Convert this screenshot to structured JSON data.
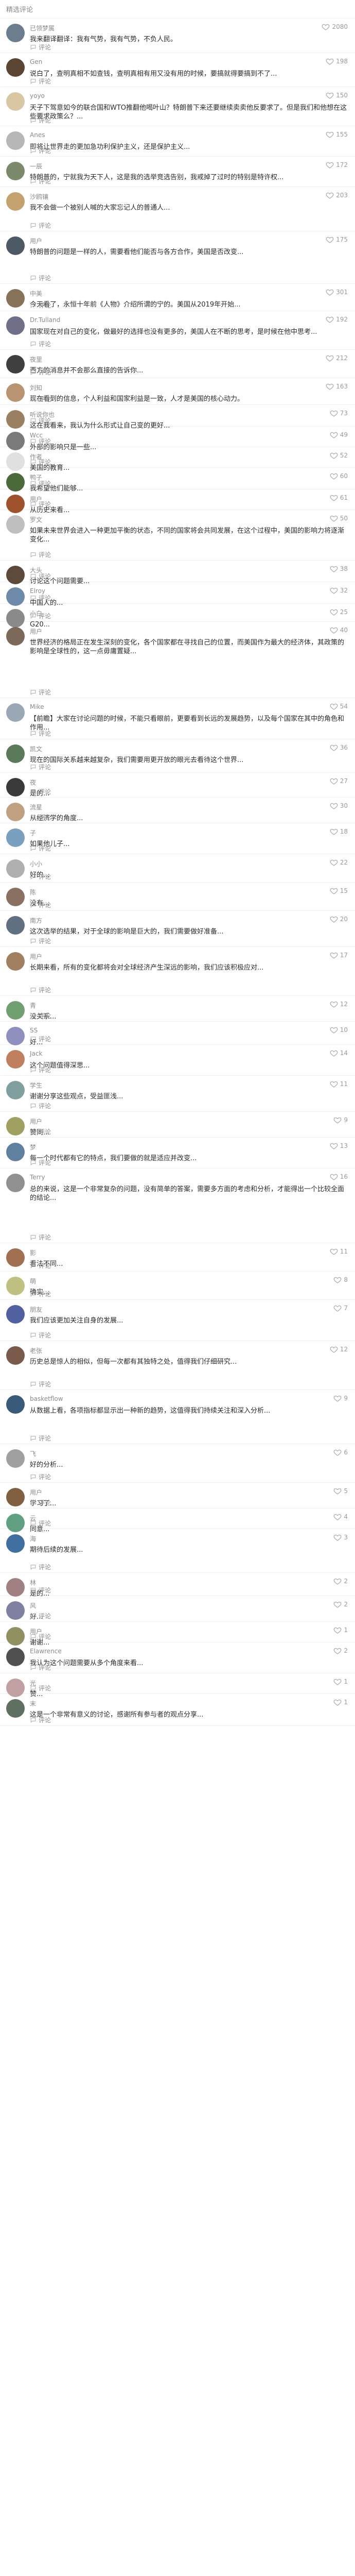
{
  "header": {
    "title": "精选评论"
  },
  "reply_label": "评论",
  "comments": [
    {
      "user": "已领梦属",
      "likes": "2080",
      "text": "我来翻译翻译：我有气势，我有气势，不负人民。",
      "av": "#6b7d8f",
      "h": 67
    },
    {
      "user": "Gen",
      "likes": "198",
      "text": "说白了，查明真相不如查钱，查明真相有用又没有用的时候，要搞就得要搞到不了...",
      "av": "#5a4632",
      "h": 66
    },
    {
      "user": "yoyo",
      "likes": "150",
      "text": "天子下驾意如今的联合国和WTO推翻他喝叶山？特朗普下来还要继续卖卖他反要求了。但是我们和他想在这些要求政策么？...",
      "av": "#d9c7a3",
      "h": 76
    },
    {
      "user": "Anes",
      "likes": "155",
      "text": "即将让世界走的更加急功利保护主义，还是保护主义...",
      "av": "#b7b7b7",
      "h": 59
    },
    {
      "user": "一辰",
      "likes": "172",
      "text": "特朗普的，宁就我为天下人，这是我的选举竞选告别，我戒掉了过时的特别是特许权...",
      "av": "#7a8a6a",
      "h": 59
    },
    {
      "user": "沙鸥镶",
      "likes": "203",
      "text": "我不会做一个被别人喊的大家忘记人的普通人...",
      "av": "#c4a26d",
      "h": 86
    },
    {
      "user": "用户",
      "likes": "175",
      "text": "特朗普的问题是一样的人，需要看他们能否与各方合作，美国是否改变...",
      "av": "#4d5a66",
      "h": 102
    },
    {
      "user": "中美",
      "likes": "301",
      "text": "今天看了，永恒十年前《人物》介绍所谓的宁的。美国从2019年开始...",
      "av": "#86735a",
      "h": 53
    },
    {
      "user": "Dr.Tulland",
      "likes": "192",
      "text": "国家现在对自己的变化，做最好的选择也没有更多的，美国人在不断的思考，是时候在他中思考...",
      "av": "#6f6f8a",
      "h": 75
    },
    {
      "user": "夜里",
      "likes": "212",
      "text": "西方的消息并不会那么直接的告诉你...",
      "av": "#3f3f3f",
      "h": 55
    },
    {
      "user": "刘知",
      "likes": "163",
      "text": "现在看到的信息，个人利益和国家利益是一致，人才是美国的核心动力。",
      "av": "#b89470",
      "h": 52
    },
    {
      "user": "听说你也",
      "likes": "73",
      "text": "这在我看来，我认为什么形式让自己变的更好...",
      "av": "#9a8060",
      "h": 42
    },
    {
      "user": "Wcc",
      "likes": "49",
      "text": "外部的影响只是一些...",
      "av": "#7a7a7a",
      "h": 40
    },
    {
      "user": "作者",
      "likes": "52",
      "text": "美国的教育...",
      "av": "#e0e0e0",
      "h": 40
    },
    {
      "user": "鸭子",
      "likes": "60",
      "text": "我希望他们能够...",
      "av": "#4a6a3a",
      "h": 42
    },
    {
      "user": "用户",
      "likes": "61",
      "text": "从历史来看...",
      "av": "#a0522d",
      "h": 40
    },
    {
      "user": "罗文",
      "likes": "50",
      "text": "如果未来世界会进入一种更加平衡的状态，不同的国家将会共同发展，在这个过程中，美国的影响力将逐渐变化...",
      "av": "#bfbfbf",
      "h": 98
    },
    {
      "user": "大头",
      "likes": "38",
      "text": "讨论这个问题需要...",
      "av": "#5c4b3a",
      "h": 42
    },
    {
      "user": "Elroy",
      "likes": "32",
      "text": "中国人的...",
      "av": "#6d8aa8",
      "h": 42
    },
    {
      "user": "小白",
      "likes": "25",
      "text": "G20...",
      "av": "#8a8a8a",
      "h": 35
    },
    {
      "user": "用户",
      "likes": "40",
      "text": "世界经济的格局正在发生深刻的变化，各个国家都在寻找自己的位置，而美国作为最大的经济体，其政策的影响是全球性的，这一点毋庸置疑...",
      "av": "#7b6a5a",
      "h": 148
    },
    {
      "user": "Mike",
      "likes": "54",
      "text": "【前瞻】大家在讨论问题的时候，不能只看眼前，更要看到长远的发展趋势，以及每个国家在其中的角色和作用...",
      "av": "#9aa7b4",
      "h": 80
    },
    {
      "user": "凯文",
      "likes": "36",
      "text": "现在的国际关系越来越复杂，我们需要用更开放的眼光去看待这个世界...",
      "av": "#5a7a5a",
      "h": 65
    },
    {
      "user": "夜",
      "likes": "27",
      "text": "是的...",
      "av": "#3a3a3a",
      "h": 48
    },
    {
      "user": "流星",
      "likes": "30",
      "text": "从经济学的角度...",
      "av": "#c0a080",
      "h": 50
    },
    {
      "user": "子",
      "likes": "18",
      "text": "如果他儿子...",
      "av": "#7aa0c0",
      "h": 60
    },
    {
      "user": "小小",
      "likes": "22",
      "text": "好的...",
      "av": "#b0b0b0",
      "h": 55
    },
    {
      "user": "陈",
      "likes": "15",
      "text": "没有...",
      "av": "#8a7060",
      "h": 55
    },
    {
      "user": "南方",
      "likes": "20",
      "text": "这次选举的结果，对于全球的影响是巨大的，我们需要做好准备...",
      "av": "#607080",
      "h": 70
    },
    {
      "user": "用户",
      "likes": "17",
      "text": "长期来看，所有的变化都将会对全球经济产生深远的影响，我们应该积极应对...",
      "av": "#a08060",
      "h": 95
    },
    {
      "user": "青",
      "likes": "12",
      "text": "没关系...",
      "av": "#70a070",
      "h": 50
    },
    {
      "user": "SS",
      "likes": "10",
      "text": "好...",
      "av": "#9090c0",
      "h": 45
    },
    {
      "user": "Jack",
      "likes": "14",
      "text": "这个问题值得深思...",
      "av": "#c08060",
      "h": 60
    },
    {
      "user": "学生",
      "likes": "11",
      "text": "谢谢分享这些观点，受益匪浅...",
      "av": "#80a0a0",
      "h": 70
    },
    {
      "user": "用户",
      "likes": "9",
      "text": "赞同...",
      "av": "#a0a060",
      "h": 50
    },
    {
      "user": "梦",
      "likes": "13",
      "text": "每一个时代都有它的特点，我们要做的就是适应并改变...",
      "av": "#6080a0",
      "h": 60
    },
    {
      "user": "Terry",
      "likes": "16",
      "text": "总的来说，这是一个非常复杂的问题，没有简单的答案，需要多方面的考虑和分析，才能得出一个比较全面的结论...",
      "av": "#909090",
      "h": 145
    },
    {
      "user": "影",
      "likes": "11",
      "text": "看法不同...",
      "av": "#a07050",
      "h": 55
    },
    {
      "user": "萌",
      "likes": "8",
      "text": "确实...",
      "av": "#c0c080",
      "h": 55
    },
    {
      "user": "朋友",
      "likes": "7",
      "text": "我们应该更加关注自身的发展...",
      "av": "#5060a0",
      "h": 80
    },
    {
      "user": "老张",
      "likes": "12",
      "text": "历史总是惊人的相似，但每一次都有其独特之处，值得我们仔细研究...",
      "av": "#7a5a4a",
      "h": 95
    },
    {
      "user": "basketflow",
      "likes": "9",
      "text": "从数据上看，各项指标都显示出一种新的趋势，这值得我们持续关注和深入分析...",
      "av": "#3a5a7a",
      "h": 105
    },
    {
      "user": "飞",
      "likes": "6",
      "text": "好的分析...",
      "av": "#a0a0a0",
      "h": 75
    },
    {
      "user": "用户",
      "likes": "5",
      "text": "学习了...",
      "av": "#806040",
      "h": 50
    },
    {
      "user": "云",
      "likes": "4",
      "text": "同意...",
      "av": "#60a080",
      "h": 40
    },
    {
      "user": "海",
      "likes": "3",
      "text": "期待后续的发展...",
      "av": "#4070a0",
      "h": 85
    },
    {
      "user": "林",
      "likes": "2",
      "text": "是的...",
      "av": "#a08080",
      "h": 45
    },
    {
      "user": "风",
      "likes": "2",
      "text": "好...",
      "av": "#8080a0",
      "h": 50
    },
    {
      "user": "用户",
      "likes": "1",
      "text": "谢谢...",
      "av": "#909060",
      "h": 40
    },
    {
      "user": "Elawrence",
      "likes": "2",
      "text": "我认为这个问题需要从多个角度来看...",
      "av": "#505050",
      "h": 60
    },
    {
      "user": "光",
      "likes": "1",
      "text": "赞...",
      "av": "#c0a0a0",
      "h": 40
    },
    {
      "user": "末",
      "likes": "1",
      "text": "这是一个非常有意义的讨论，感谢所有参与者的观点分享...",
      "av": "#607060",
      "h": 62
    }
  ]
}
